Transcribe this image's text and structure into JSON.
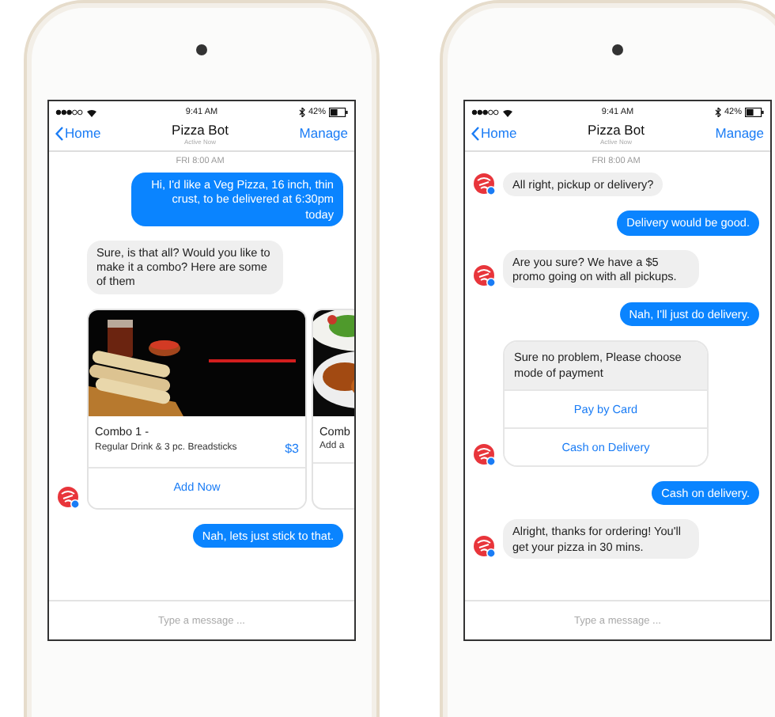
{
  "phones": [
    {
      "status": {
        "time": "9:41 AM",
        "battery": "42%"
      },
      "nav": {
        "back": "Home",
        "title": "Pizza Bot",
        "subtitle": "Active Now",
        "action": "Manage"
      },
      "timestamp": "FRI 8:00 AM",
      "messages": [
        {
          "kind": "outgoing",
          "text": "Hi, I'd like a Veg Pizza, 16 inch, thin crust, to be delivered at 6:30pm today"
        },
        {
          "kind": "incoming",
          "avatar": false,
          "text": "Sure, is that all? Would you like to make it a combo? Here are some of them"
        },
        {
          "kind": "carousel",
          "avatar": true,
          "cards": [
            {
              "title": "Combo 1 -",
              "subtitle": "Regular Drink &  3 pc. Breadsticks",
              "price": "$3",
              "button": "Add Now"
            },
            {
              "title": "Comb",
              "subtitle": "Add a"
            }
          ]
        },
        {
          "kind": "outgoing",
          "text": "Nah, lets just stick to that."
        }
      ],
      "composer": {
        "placeholder": "Type a message ..."
      }
    },
    {
      "status": {
        "time": "9:41 AM",
        "battery": "42%"
      },
      "nav": {
        "back": "Home",
        "title": "Pizza Bot",
        "subtitle": "Active Now",
        "action": "Manage"
      },
      "timestamp": "FRI 8:00 AM",
      "messages": [
        {
          "kind": "incoming",
          "avatar": true,
          "text": "All right, pickup or delivery?"
        },
        {
          "kind": "outgoing",
          "text": "Delivery would be good."
        },
        {
          "kind": "incoming",
          "avatar": true,
          "text": "Are you sure? We have a $5 promo going on with all pickups."
        },
        {
          "kind": "outgoing",
          "text": "Nah, I'll just do delivery."
        },
        {
          "kind": "buttons",
          "avatar": true,
          "text": "Sure no problem, Please choose mode of payment",
          "buttons": [
            "Pay by Card",
            "Cash on Delivery"
          ]
        },
        {
          "kind": "outgoing",
          "text": "Cash on delivery."
        },
        {
          "kind": "incoming",
          "avatar": true,
          "text": "Alright, thanks for ordering! You'll get your pizza in 30 mins."
        }
      ],
      "composer": {
        "placeholder": "Type a message ..."
      }
    }
  ]
}
